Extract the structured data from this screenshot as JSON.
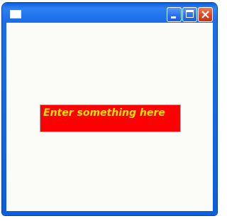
{
  "window": {
    "title": "",
    "icon": "window-icon",
    "controls": {
      "minimize_icon": "minimize-icon",
      "maximize_icon": "maximize-icon",
      "close_icon": "close-icon"
    }
  },
  "content": {
    "text_field": {
      "value": "Enter something here",
      "background_color": "#ff0000",
      "text_color": "#ffe000"
    }
  },
  "colors": {
    "titlebar": "#1a6ee8",
    "close_button": "#de4520",
    "client_background": "#fbfbf8"
  }
}
